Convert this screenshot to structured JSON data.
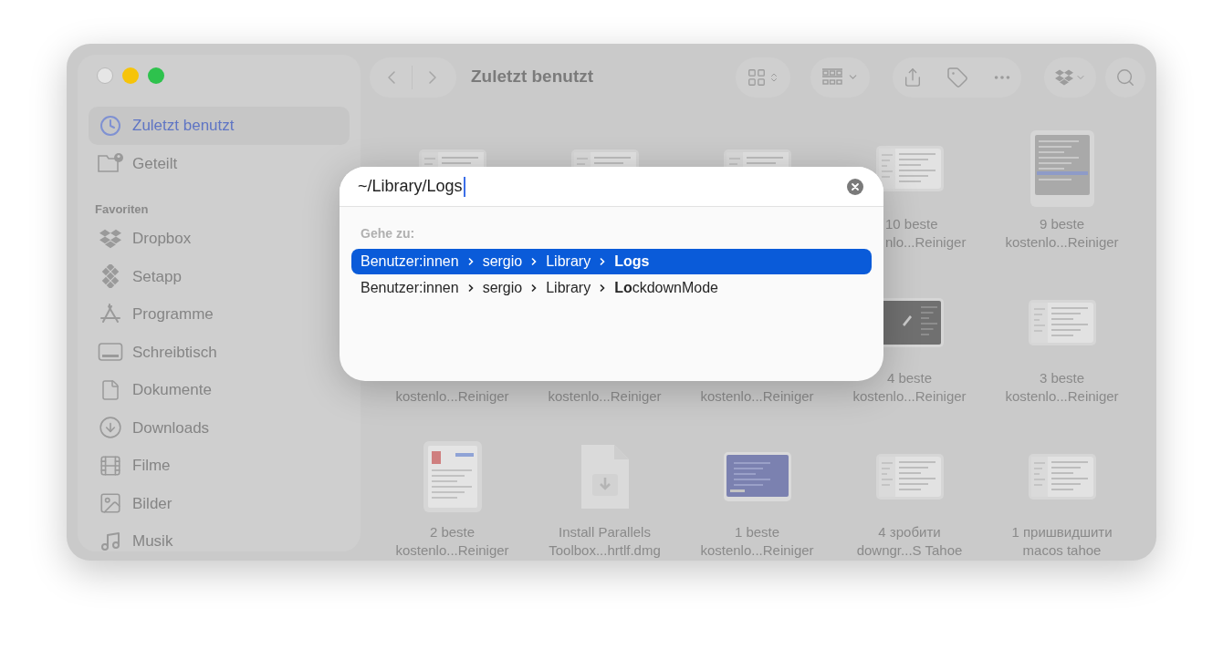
{
  "sidebar": {
    "items": [
      {
        "label": "Zuletzt benutzt",
        "selected": true
      },
      {
        "label": "Geteilt",
        "selected": false
      }
    ],
    "sections": [
      {
        "title": "Favoriten",
        "items": [
          {
            "label": "Dropbox",
            "selected": false
          },
          {
            "label": "Setapp",
            "selected": false
          },
          {
            "label": "Programme",
            "selected": false
          },
          {
            "label": "Schreibtisch",
            "selected": false
          },
          {
            "label": "Dokumente",
            "selected": false
          },
          {
            "label": "Downloads",
            "selected": false
          },
          {
            "label": "Filme",
            "selected": false
          },
          {
            "label": "Bilder",
            "selected": false
          },
          {
            "label": "Musik",
            "selected": false
          }
        ]
      }
    ]
  },
  "toolbar": {
    "title": "Zuletzt benutzt"
  },
  "files": [
    {
      "kind": "covered-screenshot"
    },
    {
      "kind": "covered-screenshot"
    },
    {
      "kind": "covered-screenshot"
    },
    {
      "kind": "screenshot",
      "label": {
        "kind": "covered",
        "lines": [
          "10 beste",
          "nlo...Reiniger"
        ]
      }
    },
    {
      "kind": "gray-screenshot",
      "label": {
        "kind": "plain",
        "lines": [
          "9 beste",
          "kostenlo...Reiniger"
        ]
      }
    },
    {
      "kind": "hidden",
      "label": {
        "kind": "plain",
        "lines": [
          "kostenlo...Reiniger"
        ]
      }
    },
    {
      "kind": "hidden",
      "label": {
        "kind": "plain",
        "lines": [
          "kostenlo...Reiniger"
        ]
      }
    },
    {
      "kind": "hidden",
      "label": {
        "kind": "plain",
        "lines": [
          "kostenlo...Reiniger"
        ]
      }
    },
    {
      "kind": "dark-screenshot",
      "label": {
        "kind": "plain",
        "lines": [
          "4 beste",
          "kostenlo...Reiniger"
        ]
      }
    },
    {
      "kind": "screenshot",
      "label": {
        "kind": "plain",
        "lines": [
          "3 beste",
          "kostenlo...Reiniger"
        ]
      }
    },
    {
      "kind": "portrait-screenshot",
      "label": {
        "kind": "plain",
        "lines": [
          "2 beste",
          "kostenlo...Reiniger"
        ]
      }
    },
    {
      "kind": "document",
      "label": {
        "kind": "plain",
        "lines": [
          "Install Parallels",
          "Toolbox...hrtlf.dmg"
        ]
      }
    },
    {
      "kind": "blue-screenshot",
      "label": {
        "kind": "plain",
        "lines": [
          "1 beste",
          "kostenlo...Reiniger"
        ]
      }
    },
    {
      "kind": "screenshot",
      "label": {
        "kind": "plain",
        "lines": [
          "4 зробити",
          "downgr...S Tahoe"
        ]
      }
    },
    {
      "kind": "screenshot",
      "label": {
        "kind": "plain",
        "lines": [
          "1 пришвидшити",
          "macos tahoe"
        ]
      }
    }
  ],
  "goto_dialog": {
    "value": "~/Library/Logs",
    "section_label": "Gehe zu:",
    "results": [
      {
        "segments": [
          "Benutzer:innen",
          "sergio",
          "Library",
          "**Logs**"
        ],
        "selected": true
      },
      {
        "segments": [
          "Benutzer:innen",
          "sergio",
          "Library",
          "**Lo**ckdownMode"
        ],
        "selected": false
      }
    ]
  }
}
